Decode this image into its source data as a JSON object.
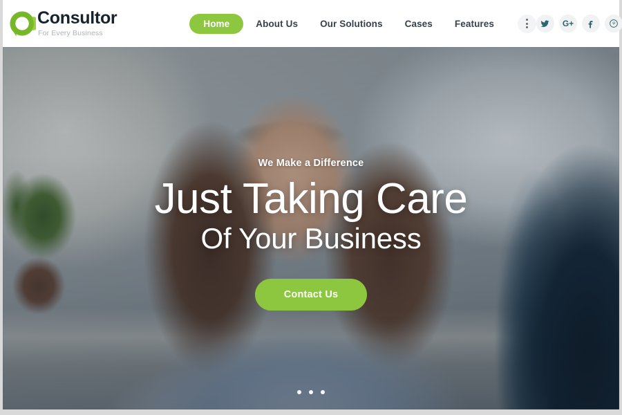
{
  "brand": {
    "name": "Consultor",
    "tagline": "For Every Business",
    "logo_icon": "speech-bubble-c-icon",
    "accent_color": "#8dc63f",
    "title_color": "#16232e",
    "tagline_color": "#aeb4b9"
  },
  "nav": {
    "items": [
      {
        "label": "Home",
        "active": true
      },
      {
        "label": "About Us",
        "active": false
      },
      {
        "label": "Our Solutions",
        "active": false
      },
      {
        "label": "Cases",
        "active": false
      },
      {
        "label": "Features",
        "active": false
      }
    ],
    "more_menu_icon": "kebab-menu-icon"
  },
  "social": {
    "items": [
      {
        "name": "twitter",
        "icon": "twitter-icon",
        "label": "Twitter"
      },
      {
        "name": "google-plus",
        "icon": "google-plus-icon",
        "label": "G+"
      },
      {
        "name": "facebook",
        "icon": "facebook-icon",
        "label": "Facebook"
      },
      {
        "name": "pinterest",
        "icon": "pinterest-icon",
        "label": "Pinterest"
      }
    ],
    "icon_color": "#2c6570",
    "button_bg": "#f0f2f3"
  },
  "hero": {
    "eyebrow": "We Make a Difference",
    "title_line_1": "Just Taking Care",
    "title_line_2": "Of Your Business",
    "cta_label": "Contact Us",
    "cta_color": "#8dc63f",
    "image_description": "Smiling businesswoman with glasses at an office desk, blurred plant on the left and mesh office chair on the right",
    "carousel": {
      "slide_count": 3,
      "active_index": 0
    }
  }
}
